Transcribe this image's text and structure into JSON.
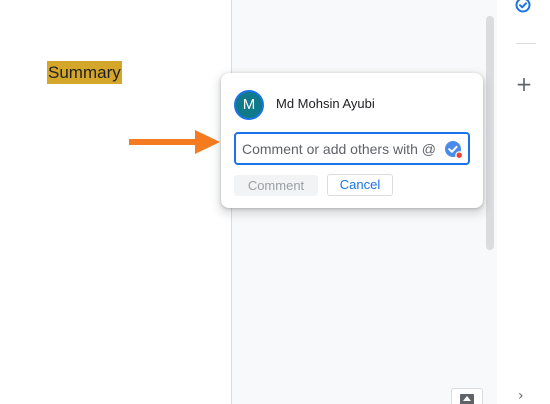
{
  "document": {
    "highlighted_text": "Summary",
    "highlight_color": "#d4a62a"
  },
  "comment_card": {
    "avatar_initial": "M",
    "author_name": "Md Mohsin Ayubi",
    "input_value": "",
    "input_placeholder": "Comment or add others with @",
    "comment_button_label": "Comment",
    "cancel_button_label": "Cancel"
  },
  "right_rail": {
    "plus_glyph": "+",
    "chevron_glyph": "›"
  },
  "colors": {
    "accent": "#1a73e8",
    "arrow": "#f47b20",
    "avatar_bg": "#0f7a8a",
    "pane_bg": "#f8f9fa"
  },
  "icons": {
    "arrow": "right-arrow-icon",
    "assign": "assign-check-icon",
    "rail_top": "check-circle-icon",
    "rail_add": "plus-icon",
    "rail_expand": "chevron-right-icon",
    "pane_bottom": "collapse-icon"
  }
}
